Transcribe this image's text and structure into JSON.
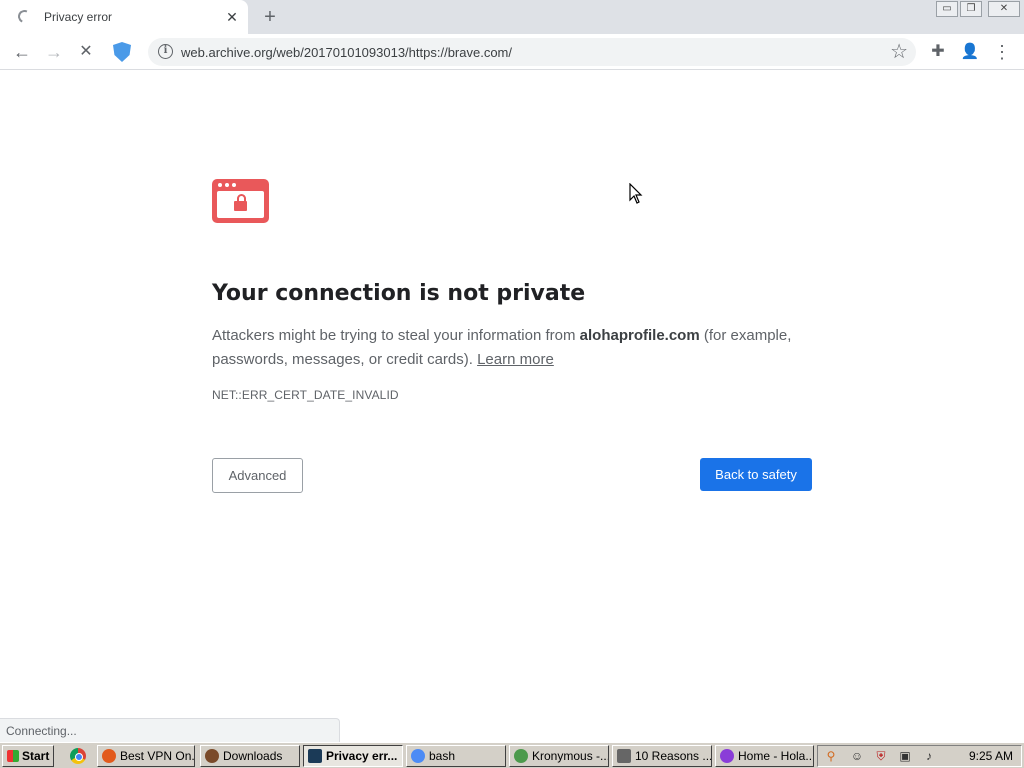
{
  "browser": {
    "tab": {
      "title": "Privacy error",
      "close_icon": "✕"
    },
    "new_tab_icon": "+",
    "window_buttons": [
      "▭",
      "❐",
      "✕"
    ],
    "toolbar": {
      "back_icon": "←",
      "forward_icon": "→",
      "stop_icon": "✕",
      "url": "web.archive.org/web/20170101093013/https://brave.com/",
      "info_icon": "i",
      "star_icon": "☆",
      "extensions_icon": "✚",
      "profile_icon": "👤",
      "menu_icon": "⋮"
    }
  },
  "interstitial": {
    "heading": "Your connection is not private",
    "body_prefix": "Attackers might be trying to steal your information from ",
    "domain": "alohaprofile.com",
    "body_suffix": " (for example, passwords, messages, or credit cards). ",
    "learn_more": "Learn more",
    "error_code": "NET::ERR_CERT_DATE_INVALID",
    "advanced_label": "Advanced",
    "back_label": "Back to safety",
    "colors": {
      "icon": "#e9585a",
      "primary_button": "#1a73e8"
    }
  },
  "status_bubble": "Connecting...",
  "taskbar": {
    "start_label": "Start",
    "tasks": [
      {
        "label": "Best VPN On...",
        "icon_color": "#e25a1c",
        "active": false
      },
      {
        "label": "Downloads",
        "icon_color": "#7a4a2a",
        "active": false
      },
      {
        "label": "Privacy err...",
        "icon_color": "#1b3a57",
        "active": true
      },
      {
        "label": "bash",
        "icon_color": "#4c8bf5",
        "active": false
      },
      {
        "label": "Kronymous -...",
        "icon_color": "#4c9a4c",
        "active": false
      },
      {
        "label": "10 Reasons ...",
        "icon_color": "#666666",
        "active": false
      },
      {
        "label": "Home - Hola...",
        "icon_color": "#8a3dd8",
        "active": false
      }
    ],
    "clock": "9:25 AM"
  }
}
